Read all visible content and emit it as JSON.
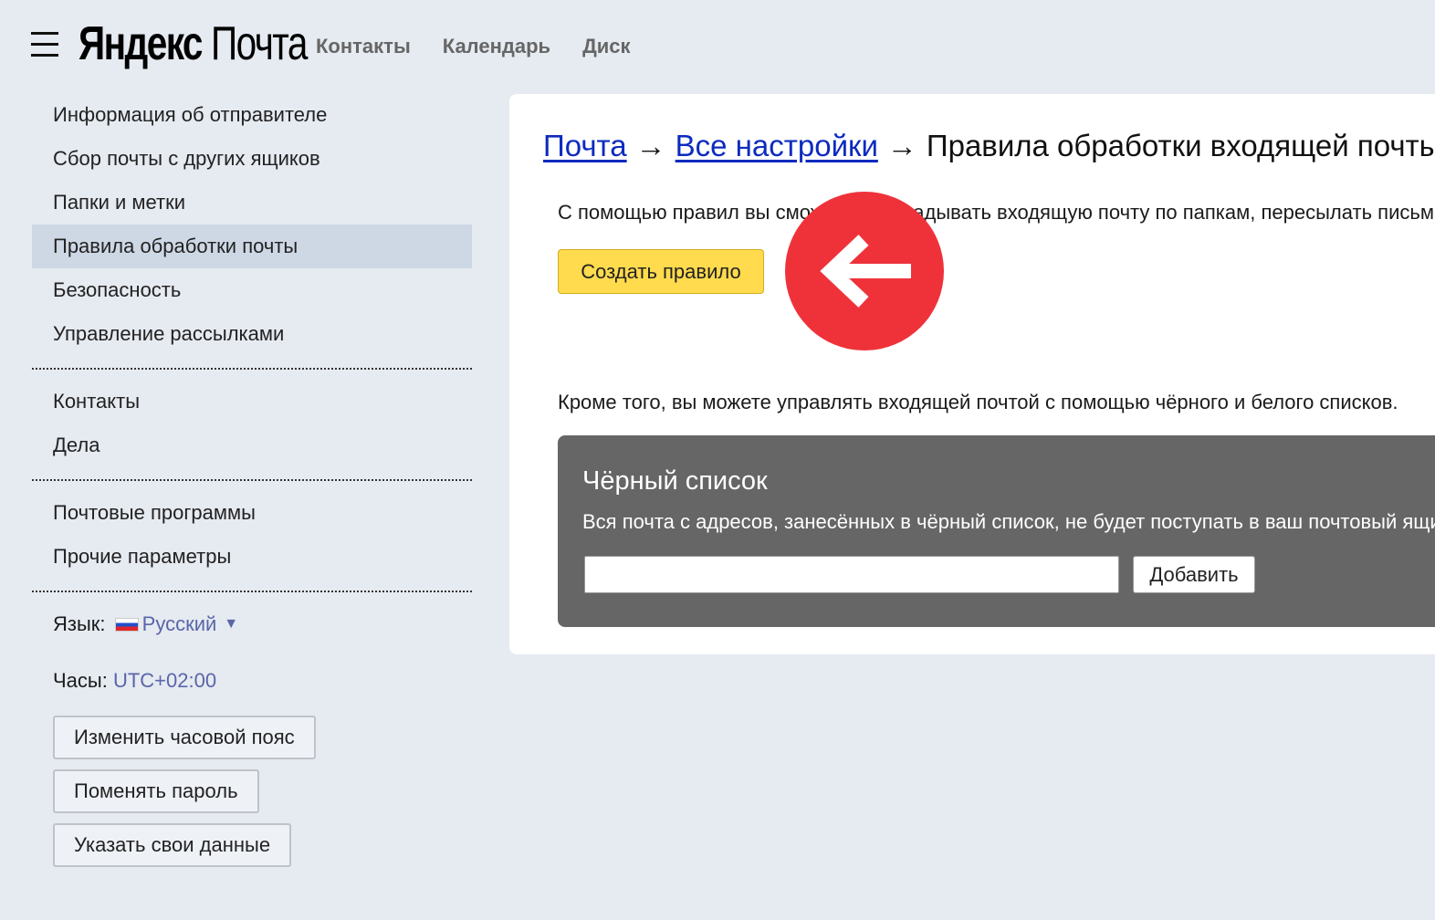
{
  "header": {
    "logo_brand": "Яндекс",
    "logo_product": "Почта",
    "nav": [
      "Контакты",
      "Календарь",
      "Диск"
    ]
  },
  "sidebar": {
    "items": [
      "Информация об отправителе",
      "Сбор почты с других ящиков",
      "Папки и метки",
      "Правила обработки почты",
      "Безопасность",
      "Управление рассылками"
    ],
    "active_index": 3,
    "items_group2": [
      "Контакты",
      "Дела"
    ],
    "items_group3": [
      "Почтовые программы",
      "Прочие параметры"
    ],
    "language_label": "Язык:",
    "language_value": "Русский",
    "clock_label": "Часы:",
    "clock_value": "UTC+02:00",
    "buttons": [
      "Изменить часовой пояс",
      "Поменять пароль",
      "Указать свои данные"
    ]
  },
  "main": {
    "breadcrumb": {
      "mail": "Почта",
      "all_settings": "Все настройки",
      "current": "Правила обработки входящей почты",
      "separator": "→"
    },
    "intro_text": "С помощью правил вы сможете раскладывать входящую почту по папкам, пересылать письма",
    "create_button": "Создать правило",
    "lists_note": "Кроме того, вы можете управлять входящей почтой с помощью чёрного и белого списков.",
    "blacklist": {
      "title": "Чёрный список",
      "description": "Вся почта с адресов, занесённых в чёрный список, не будет поступать в ваш почтовый ящик.",
      "input_value": "",
      "add_button": "Добавить"
    }
  },
  "overlay": {
    "icon": "arrow-left-icon",
    "color": "#ef323a"
  },
  "colors": {
    "background": "#e6eaf1",
    "active_item": "#ced8e5",
    "accent_button": "#ffdb4d",
    "link": "#0d2bbf",
    "blacklist_bg": "#666666"
  }
}
